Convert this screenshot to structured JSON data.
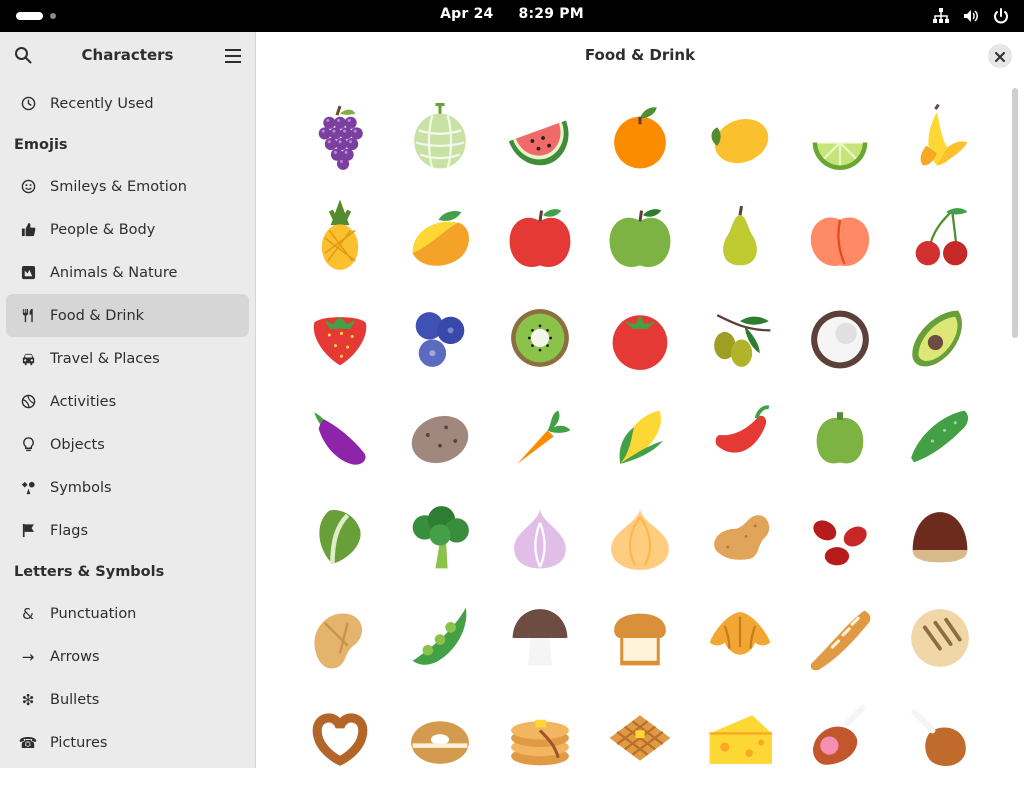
{
  "topbar": {
    "date": "Apr 24",
    "time": "8:29 PM"
  },
  "sidebar": {
    "title": "Characters",
    "recent": {
      "label": "Recently Used",
      "icon": "clock-icon"
    },
    "section_emojis": "Emojis",
    "emoji_items": [
      {
        "label": "Smileys & Emotion",
        "icon": "smiley-icon"
      },
      {
        "label": "People & Body",
        "icon": "thumbs-up-icon"
      },
      {
        "label": "Animals & Nature",
        "icon": "animal-icon"
      },
      {
        "label": "Food & Drink",
        "icon": "fork-knife-icon"
      },
      {
        "label": "Travel & Places",
        "icon": "car-icon"
      },
      {
        "label": "Activities",
        "icon": "activities-icon"
      },
      {
        "label": "Objects",
        "icon": "lightbulb-icon"
      },
      {
        "label": "Symbols",
        "icon": "symbols-icon"
      },
      {
        "label": "Flags",
        "icon": "flag-icon"
      }
    ],
    "section_letters": "Letters & Symbols",
    "letter_items": [
      {
        "label": "Punctuation",
        "icon": "ampersand-icon"
      },
      {
        "label": "Arrows",
        "icon": "arrow-icon"
      },
      {
        "label": "Bullets",
        "icon": "asterisk-icon"
      },
      {
        "label": "Pictures",
        "icon": "pictures-icon"
      }
    ],
    "active": "Food & Drink"
  },
  "main": {
    "title": "Food & Drink",
    "emojis": [
      [
        "grapes",
        "melon",
        "watermelon",
        "tangerine",
        "lemon",
        "lime",
        "banana"
      ],
      [
        "pineapple",
        "mango",
        "red-apple",
        "green-apple",
        "pear",
        "peach",
        "cherries"
      ],
      [
        "strawberry",
        "blueberries",
        "kiwi",
        "tomato",
        "olive",
        "coconut",
        "avocado"
      ],
      [
        "eggplant",
        "potato",
        "carrot",
        "corn",
        "hot-pepper",
        "bell-pepper",
        "cucumber"
      ],
      [
        "leafy-green",
        "broccoli",
        "garlic",
        "onion",
        "peanuts",
        "beans",
        "chestnut"
      ],
      [
        "ginger",
        "pea-pod",
        "mushroom",
        "bread",
        "croissant",
        "baguette",
        "flatbread"
      ],
      [
        "pretzel",
        "bagel",
        "pancakes",
        "waffle",
        "cheese",
        "meat-on-bone",
        "poultry-leg"
      ]
    ]
  }
}
